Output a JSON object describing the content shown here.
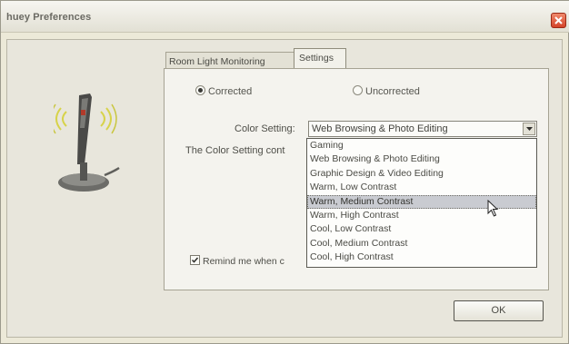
{
  "window": {
    "title": "huey Preferences"
  },
  "tabs": [
    {
      "label": "Room Light Monitoring",
      "active": false
    },
    {
      "label": "Settings",
      "active": true
    }
  ],
  "mode": {
    "corrected_label": "Corrected",
    "uncorrected_label": "Uncorrected",
    "selected": "Corrected"
  },
  "color_setting": {
    "label": "Color Setting:",
    "value": "Web Browsing & Photo Editing",
    "description_partial": "The Color Setting cont",
    "options": [
      "Gaming",
      "Web Browsing & Photo Editing",
      "Graphic Design & Video Editing",
      "Warm, Low Contrast",
      "Warm, Medium Contrast",
      "Warm, High Contrast",
      "Cool, Low Contrast",
      "Cool, Medium Contrast",
      "Cool, High Contrast"
    ],
    "highlighted": "Warm, Medium Contrast"
  },
  "reminder": {
    "label_partial": "Remind me when c",
    "checked": true
  },
  "buttons": {
    "ok": "OK"
  },
  "icons": {
    "close": "close-icon",
    "device": "colorimeter-device-icon",
    "dropdown_arrow": "chevron-down-icon",
    "cursor": "mouse-pointer-icon",
    "check": "check-icon"
  },
  "colors": {
    "close_button": "#d4432a",
    "device_glow": "#d7d34a",
    "highlight": "#c9cbd1"
  }
}
